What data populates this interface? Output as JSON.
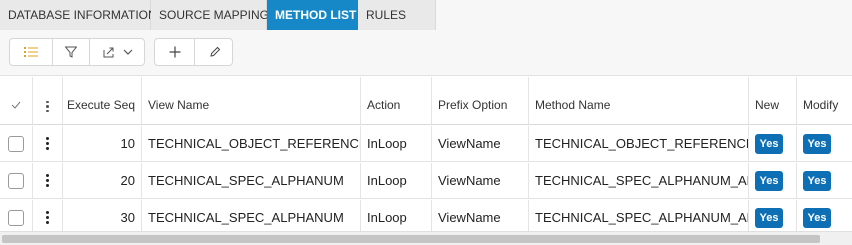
{
  "tabs": [
    {
      "label": "DATABASE INFORMATION",
      "active": false
    },
    {
      "label": "SOURCE MAPPING",
      "active": false
    },
    {
      "label": "METHOD LIST",
      "active": true
    },
    {
      "label": "RULES",
      "active": false
    }
  ],
  "toolbar": {
    "icons": [
      "list-icon",
      "filter-icon",
      "export-icon",
      "chevron-down-icon",
      "plus-icon",
      "pencil-icon"
    ]
  },
  "grid": {
    "columns": {
      "execute_seq": "Execute Seq",
      "view_name": "View Name",
      "action": "Action",
      "prefix_option": "Prefix Option",
      "method_name": "Method Name",
      "new": "New",
      "modify": "Modify"
    },
    "rows": [
      {
        "execute_seq": "10",
        "view_name": "TECHNICAL_OBJECT_REFERENCE",
        "action": "InLoop",
        "prefix_option": "ViewName",
        "method_name": "TECHNICAL_OBJECT_REFERENCE...",
        "new": "Yes",
        "modify": "Yes"
      },
      {
        "execute_seq": "20",
        "view_name": "TECHNICAL_SPEC_ALPHANUM",
        "action": "InLoop",
        "prefix_option": "ViewName",
        "method_name": "TECHNICAL_SPEC_ALPHANUM_API",
        "new": "Yes",
        "modify": "Yes"
      },
      {
        "execute_seq": "30",
        "view_name": "TECHNICAL_SPEC_ALPHANUM",
        "action": "InLoop",
        "prefix_option": "ViewName",
        "method_name": "TECHNICAL_SPEC_ALPHANUM_API",
        "new": "Yes",
        "modify": "Yes"
      }
    ]
  },
  "colors": {
    "tab_active": "#1688c8",
    "yes_badge": "#0f6fb5"
  }
}
